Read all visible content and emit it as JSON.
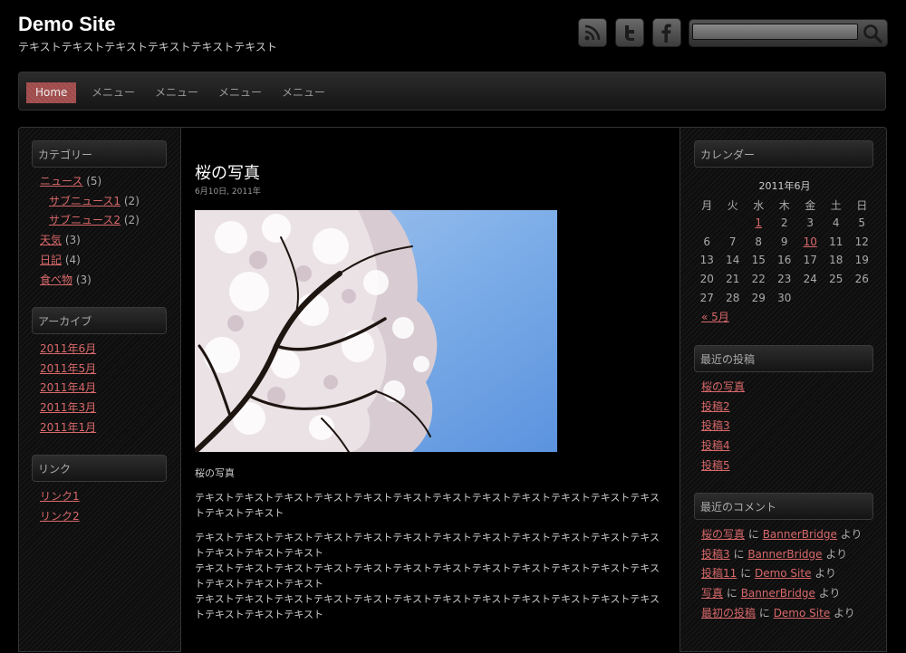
{
  "header": {
    "title": "Demo Site",
    "description": "テキストテキストテキストテキストテキストテキスト",
    "social": [
      "rss-icon",
      "twitter-icon",
      "facebook-icon"
    ],
    "search_placeholder": ""
  },
  "nav": {
    "items": [
      "Home",
      "メニュー",
      "メニュー",
      "メニュー",
      "メニュー"
    ],
    "active_color": "#9f4a4a"
  },
  "left": {
    "categories_title": "カテゴリー",
    "categories": [
      {
        "label": "ニュース",
        "count": "(5)"
      },
      {
        "label": "サブニュース1",
        "count": "(2)"
      },
      {
        "label": "サブニュース2",
        "count": "(2)"
      },
      {
        "label": "天気",
        "count": "(3)"
      },
      {
        "label": "日記",
        "count": "(4)"
      },
      {
        "label": "食べ物",
        "count": "(3)"
      }
    ],
    "archives_title": "アーカイブ",
    "archives": [
      "2011年6月",
      "2011年5月",
      "2011年4月",
      "2011年3月",
      "2011年1月"
    ],
    "links_title": "リンク",
    "links": [
      "リンク1",
      "リンク2"
    ]
  },
  "post": {
    "title": "桜の写真",
    "date": "6月10日, 2011年",
    "caption": "桜の写真",
    "paragraphs": [
      "テキストテキストテキストテキストテキストテキストテキストテキストテキストテキストテキストテキストテキストテキスト",
      "テキストテキストテキストテキストテキストテキストテキストテキストテキストテキストテキストテキストテキストテキストテキスト\nテキストテキストテキストテキストテキストテキストテキストテキストテキストテキストテキストテキストテキストテキストテキスト\nテキストテキストテキストテキストテキストテキストテキストテキストテキストテキストテキストテキストテキストテキストテキスト"
    ]
  },
  "right": {
    "calendar_title": "カレンダー",
    "calendar_caption": "2011年6月",
    "weekdays": [
      "月",
      "火",
      "水",
      "木",
      "金",
      "土",
      "日"
    ],
    "weeks": [
      [
        "",
        "",
        "1",
        "2",
        "3",
        "4",
        "5"
      ],
      [
        "6",
        "7",
        "8",
        "9",
        "10",
        "11",
        "12"
      ],
      [
        "13",
        "14",
        "15",
        "16",
        "17",
        "18",
        "19"
      ],
      [
        "20",
        "21",
        "22",
        "23",
        "24",
        "25",
        "26"
      ],
      [
        "27",
        "28",
        "29",
        "30",
        "",
        "",
        ""
      ]
    ],
    "linked_days": [
      "1",
      "10"
    ],
    "prev_month": "« 5月",
    "recent_posts_title": "最近の投稿",
    "recent_posts": [
      "桜の写真",
      "投稿2",
      "投稿3",
      "投稿4",
      "投稿5"
    ],
    "recent_comments_title": "最近のコメント",
    "recent_comments": [
      {
        "post": "桜の写真",
        "joiner": "に",
        "author": "BannerBridge",
        "suffix": "より"
      },
      {
        "post": "投稿3",
        "joiner": "に",
        "author": "BannerBridge",
        "suffix": "より"
      },
      {
        "post": "投稿11",
        "joiner": "に",
        "author": "Demo Site",
        "suffix": "より"
      },
      {
        "post": "写真",
        "joiner": "に",
        "author": "BannerBridge",
        "suffix": "より"
      },
      {
        "post": "最初の投稿",
        "joiner": "に",
        "author": "Demo Site",
        "suffix": "より"
      }
    ]
  }
}
